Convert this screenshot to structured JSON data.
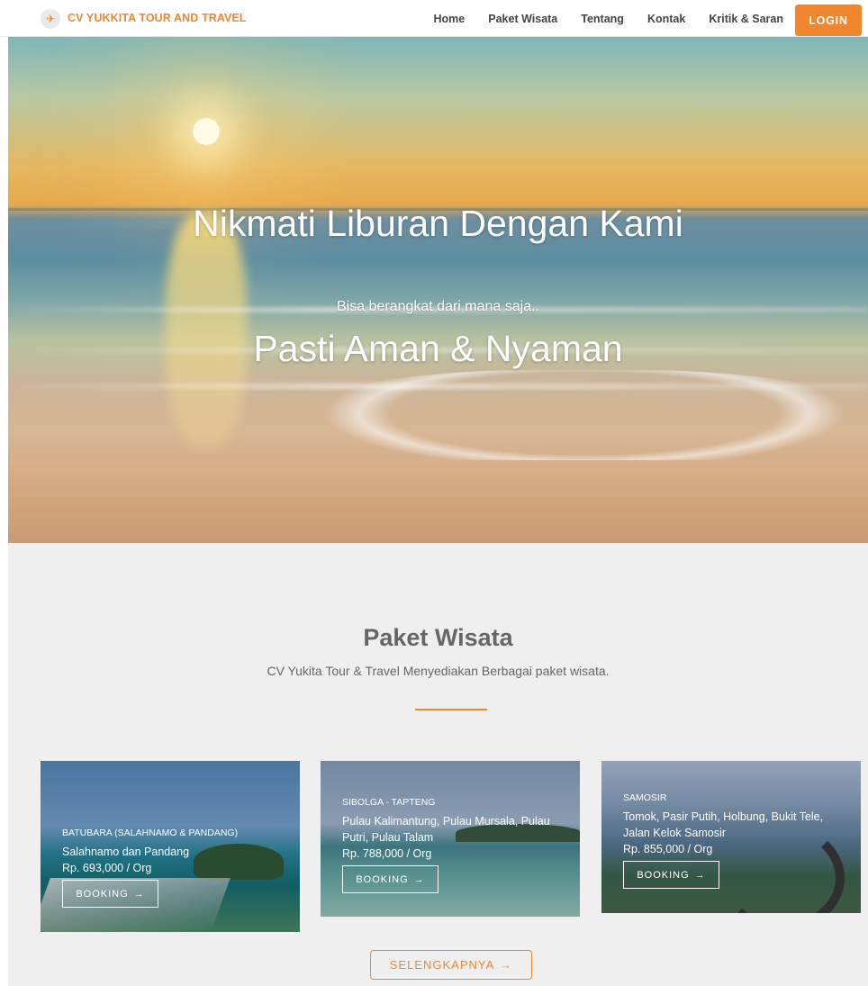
{
  "navbar": {
    "brand_logo": "✈",
    "brand_text": "CV YUKKITA TOUR AND TRAVEL",
    "links": [
      "Home",
      "Paket Wisata",
      "Tentang",
      "Kontak",
      "Kritik & Saran"
    ],
    "login_label": "LOGIN"
  },
  "hero": {
    "title": "Nikmati Liburan Dengan Kami",
    "subtitle": "Bisa berangkat dari mana saja..",
    "tagline": "Pasti Aman & Nyaman"
  },
  "paket": {
    "title": "Paket Wisata",
    "subtitle": "CV Yukita Tour & Travel Menyediakan Berbagai paket wisata.",
    "cards": [
      {
        "region": "BATUBARA (SALAHNAMO & PANDANG)",
        "destinations": "Salahnamo dan Pandang",
        "price": "Rp. 693,000 / Org",
        "button": "BOOKING",
        "arrow": "→"
      },
      {
        "region": "SIBOLGA - TAPTENG",
        "destinations": "Pulau Kalimantung, Pulau Mursala, Pulau Putri, Pulau Talam",
        "price": "Rp. 788,000 / Org",
        "button": "BOOKING",
        "arrow": "→"
      },
      {
        "region": "SAMOSIR",
        "destinations": "Tomok, Pasir Putih, Holbung, Bukit Tele, Jalan Kelok Samosir",
        "price": "Rp. 855,000 / Org",
        "button": "BOOKING",
        "arrow": "→"
      }
    ],
    "more_label": "SELENGKAPNYA",
    "more_arrow": "→"
  },
  "colors": {
    "accent": "#f0872f",
    "section_bg": "#efefef"
  }
}
